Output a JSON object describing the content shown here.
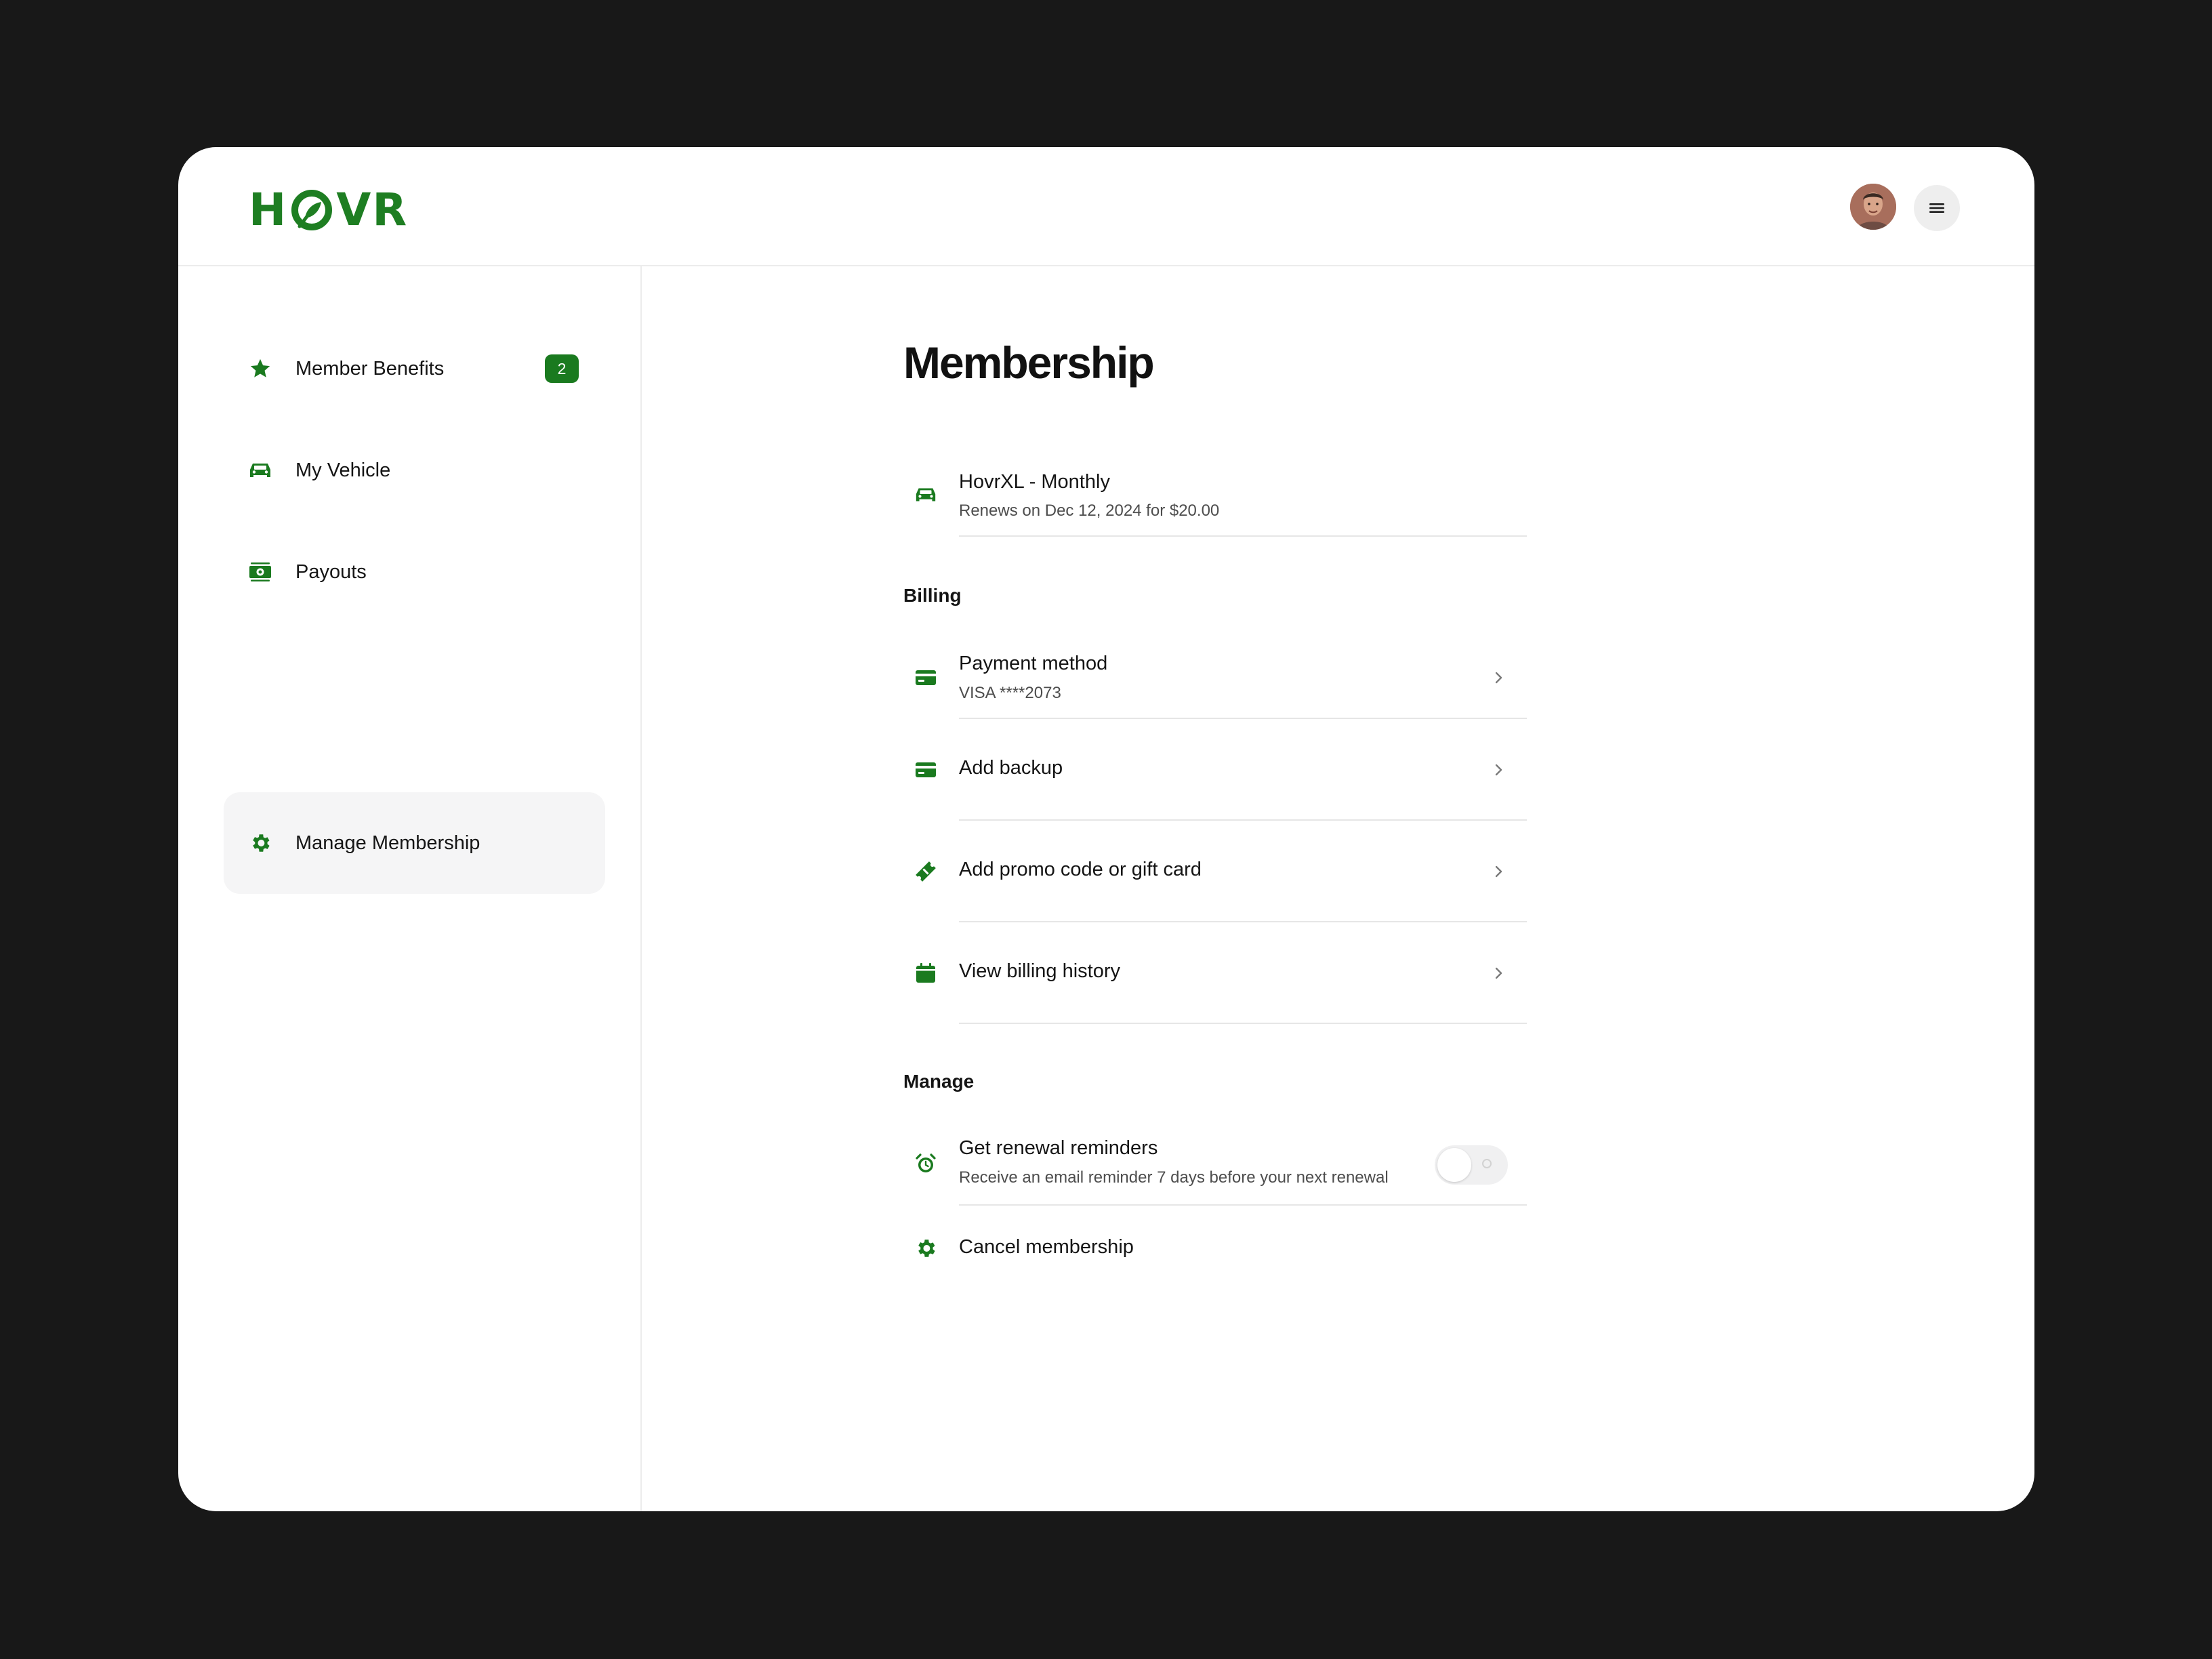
{
  "app": {
    "logo_text_left": "H",
    "logo_text_right": "VR",
    "brand_color": "#1e7e22",
    "avatar_icon": "user-avatar",
    "menu_icon": "hamburger-menu-icon"
  },
  "sidebar": {
    "items": [
      {
        "label": "Member Benefits",
        "icon": "star-icon",
        "badge": "2",
        "active": false
      },
      {
        "label": "My Vehicle",
        "icon": "car-icon",
        "active": false
      },
      {
        "label": "Payouts",
        "icon": "money-icon",
        "active": false
      },
      {
        "label": "Manage Membership",
        "icon": "gear-icon",
        "active": true
      }
    ]
  },
  "main": {
    "title": "Membership",
    "plan": {
      "name": "HovrXL - Monthly",
      "renewal": "Renews on Dec 12, 2024 for $20.00",
      "icon": "car-icon"
    },
    "billing": {
      "section_title": "Billing",
      "payment_method": {
        "label": "Payment method",
        "value": "VISA ****2073",
        "icon": "credit-card-icon"
      },
      "add_backup": {
        "label": "Add backup",
        "icon": "credit-card-icon"
      },
      "promo": {
        "label": "Add promo code or gift card",
        "icon": "ticket-icon"
      },
      "history": {
        "label": "View billing history",
        "icon": "calendar-icon"
      }
    },
    "manage": {
      "section_title": "Manage",
      "reminders": {
        "label": "Get renewal reminders",
        "description": "Receive an email reminder 7 days before your next renewal",
        "enabled": false,
        "icon": "alarm-clock-icon"
      },
      "cancel": {
        "label": "Cancel membership",
        "icon": "gear-icon"
      }
    }
  }
}
